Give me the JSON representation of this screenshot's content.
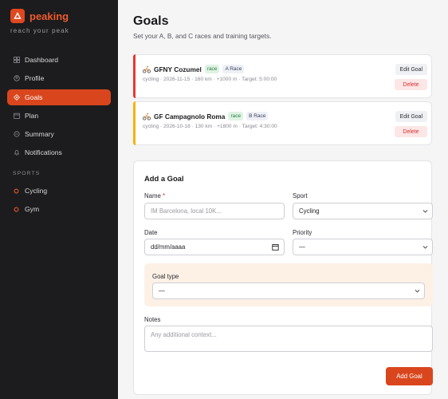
{
  "app": {
    "name": "peaking",
    "tagline": "reach your peak"
  },
  "nav": [
    {
      "label": "Dashboard",
      "icon": "grid-icon"
    },
    {
      "label": "Profile",
      "icon": "user-icon"
    },
    {
      "label": "Goals",
      "icon": "target-icon",
      "active": true
    },
    {
      "label": "Plan",
      "icon": "calendar-icon"
    },
    {
      "label": "Summary",
      "icon": "chart-icon"
    },
    {
      "label": "Notifications",
      "icon": "bell-icon"
    }
  ],
  "sports_section": {
    "label": "SPORTS",
    "items": [
      {
        "label": "Cycling",
        "icon": "cycling-dot-icon"
      },
      {
        "label": "Gym",
        "icon": "gym-dot-icon"
      }
    ]
  },
  "page": {
    "title": "Goals",
    "subtitle": "Set your A, B, and C races and training targets."
  },
  "goals": [
    {
      "name": "GFNY Cozumel",
      "type_badge": "race",
      "tier_badge": "A Race",
      "meta": "cycling · 2026-11-15 · 160 km · +1000 m · Target: 5:00:00",
      "accent": "#e53935",
      "edit_label": "Edit Goal",
      "delete_label": "Delete"
    },
    {
      "name": "GF Campagnolo Roma",
      "type_badge": "race",
      "tier_badge": "B Race",
      "meta": "cycling · 2026-10-18 · 130 km · +1800 m · Target: 4:30:00",
      "accent": "#f4b400",
      "edit_label": "Edit Goal",
      "delete_label": "Delete"
    }
  ],
  "form": {
    "title": "Add a Goal",
    "name_label": "Name",
    "name_required": "*",
    "name_placeholder": "IM Barcelona, local 10K...",
    "sport_label": "Sport",
    "sport_value": "Cycling",
    "date_label": "Date",
    "date_placeholder": "dd/mm/aaaa",
    "priority_label": "Priority",
    "priority_value": "—",
    "goal_type_label": "Goal type",
    "goal_type_value": "—",
    "notes_label": "Notes",
    "notes_placeholder": "Any additional context...",
    "submit_label": "Add Goal"
  },
  "colors": {
    "accent": "#d9461d",
    "sidebar_bg": "#1c1c1e",
    "a_race": "#e53935",
    "b_race": "#f4b400"
  }
}
